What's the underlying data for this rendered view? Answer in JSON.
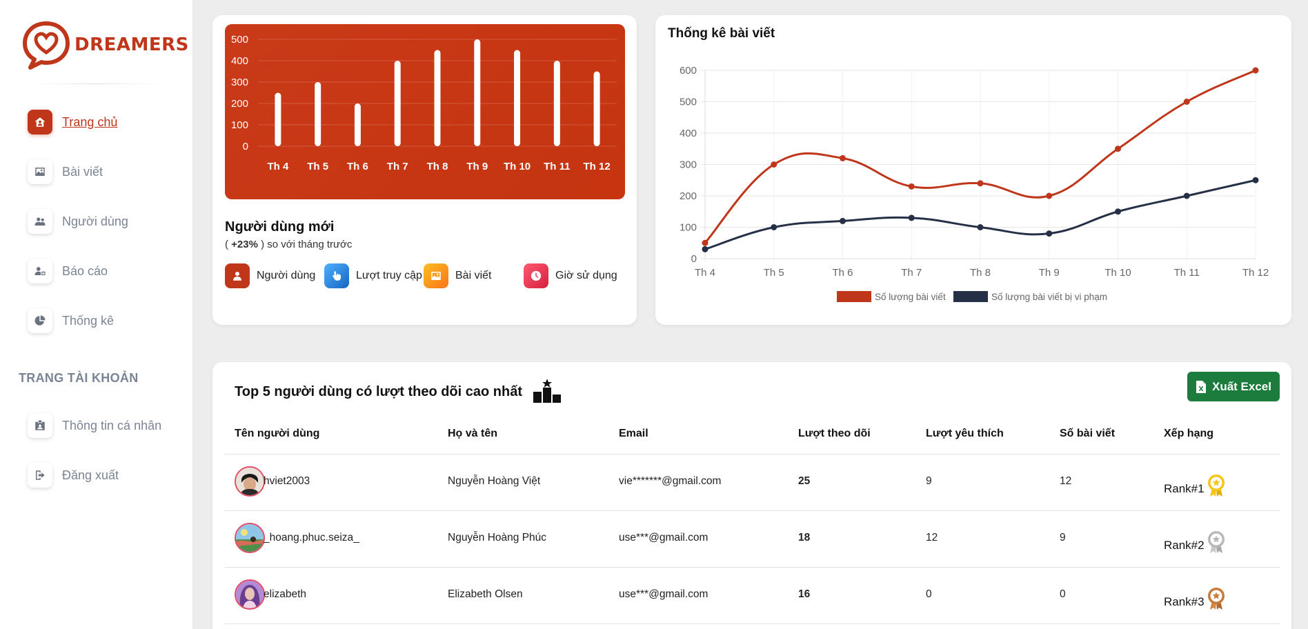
{
  "brand": {
    "name": "DREAMERS"
  },
  "sidebar": {
    "items": [
      {
        "label": "Trang chủ",
        "icon": "home-icon",
        "active": true
      },
      {
        "label": "Bài viết",
        "icon": "image-icon"
      },
      {
        "label": "Người dùng",
        "icon": "users-icon"
      },
      {
        "label": "Báo cáo",
        "icon": "user-report-icon"
      }
    ],
    "item_stats": {
      "label": "Thống kê",
      "icon": "pie-chart-icon"
    },
    "section_title": "TRANG TÀI KHOẢN",
    "account_items": [
      {
        "label": "Thông tin cá nhân",
        "icon": "id-card-icon"
      },
      {
        "label": "Đăng xuất",
        "icon": "logout-icon"
      }
    ]
  },
  "new_users": {
    "title": "Người dùng mới",
    "change": "+23%",
    "change_prefix": "( ",
    "change_suffix": " ) so với tháng trước",
    "stats": [
      {
        "label": "Người dùng",
        "icon": "user-icon",
        "color": "#c0361a"
      },
      {
        "label": "Lượt truy cập",
        "icon": "pointer-icon",
        "color": "#1e88e5"
      },
      {
        "label": "Bài viết",
        "icon": "picture-icon",
        "color": "#f59e0b"
      },
      {
        "label": "Giờ sử dụng",
        "icon": "clock-icon",
        "color": "#e53950"
      }
    ]
  },
  "post_stats": {
    "title": "Thống kê bài viết"
  },
  "chart_data": [
    {
      "type": "bar",
      "categories": [
        "Th 4",
        "Th 5",
        "Th 6",
        "Th 7",
        "Th 8",
        "Th 9",
        "Th 10",
        "Th 11",
        "Th 12"
      ],
      "values": [
        250,
        300,
        200,
        400,
        450,
        500,
        450,
        400,
        350
      ],
      "ylim": [
        0,
        500
      ],
      "yticks": [
        0,
        100,
        200,
        300,
        400,
        500
      ],
      "grid": true
    },
    {
      "type": "line",
      "title": "Thống kê bài viết",
      "categories": [
        "Th 4",
        "Th 5",
        "Th 6",
        "Th 7",
        "Th 8",
        "Th 9",
        "Th 10",
        "Th 11",
        "Th 12"
      ],
      "series": [
        {
          "name": "Số lượng bài viết",
          "color": "#c0361a",
          "values": [
            50,
            300,
            320,
            230,
            240,
            200,
            350,
            500,
            600
          ]
        },
        {
          "name": "Số lượng bài viết bị vi phạm",
          "color": "#253046",
          "values": [
            30,
            100,
            120,
            130,
            100,
            80,
            150,
            200,
            250
          ]
        }
      ],
      "ylim": [
        0,
        600
      ],
      "yticks": [
        0,
        100,
        200,
        300,
        400,
        500,
        600
      ],
      "legend": "bottom",
      "grid": true
    }
  ],
  "top_users": {
    "title": "Top 5 người dùng có lượt theo dõi cao nhất",
    "export_label": "Xuất Excel",
    "columns": [
      "Tên người dùng",
      "Họ và tên",
      "Email",
      "Lượt theo dõi",
      "Lượt yêu thích",
      "Số bài viết",
      "Xếp hạng"
    ],
    "rows": [
      {
        "username": "hviet2003",
        "fullname": "Nguyễn Hoàng Việt",
        "email": "vie*******@gmail.com",
        "followers": "25",
        "likes": "9",
        "posts": "12",
        "rank": "Rank#1",
        "medal_color": "#f5c518"
      },
      {
        "username": "_hoang.phuc.seiza_",
        "fullname": "Nguyễn Hoàng Phúc",
        "email": "use***@gmail.com",
        "followers": "18",
        "likes": "12",
        "posts": "9",
        "rank": "Rank#2",
        "medal_color": "#b8b8b8"
      },
      {
        "username": "elizabeth",
        "fullname": "Elizabeth Olsen",
        "email": "use***@gmail.com",
        "followers": "16",
        "likes": "0",
        "posts": "0",
        "rank": "Rank#3",
        "medal_color": "#c87a3a"
      }
    ]
  }
}
